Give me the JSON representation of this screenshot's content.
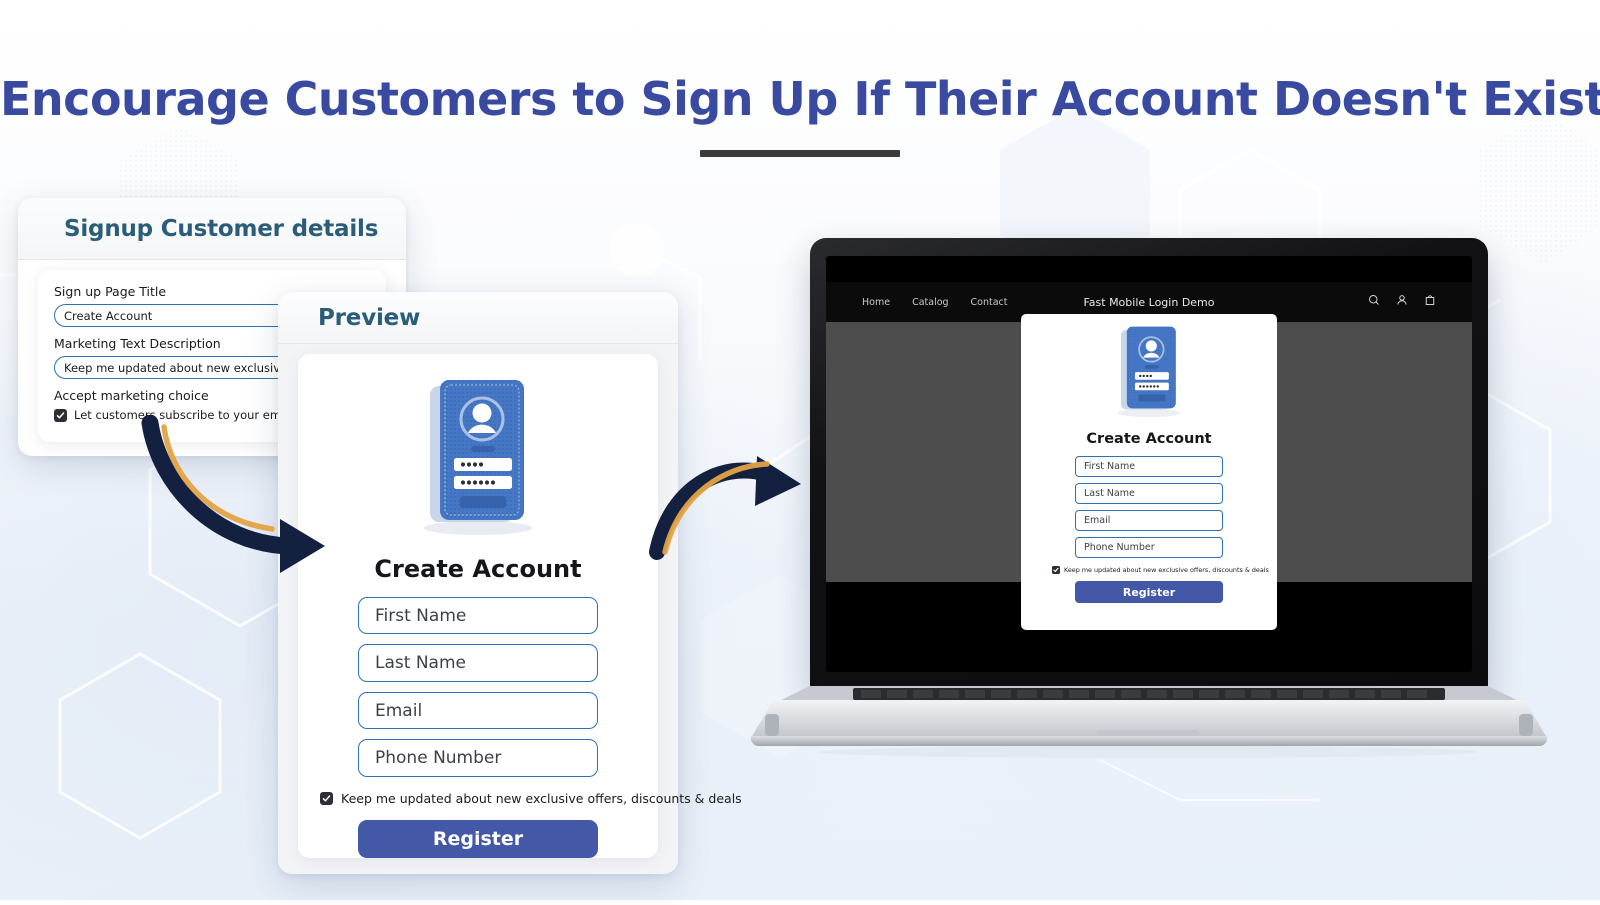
{
  "page": {
    "title": "Encourage Customers to Sign Up If Their Account Doesn't Exist"
  },
  "colors": {
    "title": "#3a4aa0",
    "panel_header_text": "#2b5d79",
    "input_border": "#2f6fb5",
    "primary_button": "#4359a8",
    "arrow_navy": "#14203f",
    "arrow_gold": "#e3a344",
    "screen_overlay": "#4d4d4d",
    "nav_bar": "#0b0b0c"
  },
  "settings_panel": {
    "header": "Signup Customer details",
    "fields": [
      {
        "label": "Sign up Page Title",
        "value": "Create Account"
      },
      {
        "label": "Marketing Text Description",
        "value": "Keep me updated about new exclusive offers, discounts & deals"
      }
    ],
    "checkbox_label": "Accept marketing choice",
    "checkbox_text": "Let customers subscribe to your email marketing campaigns",
    "checkbox_checked": true
  },
  "preview_panel": {
    "header": "Preview",
    "illustration": "mobile-login-illustration",
    "form": {
      "title": "Create Account",
      "inputs": [
        {
          "placeholder": "First Name"
        },
        {
          "placeholder": "Last Name"
        },
        {
          "placeholder": "Email"
        },
        {
          "placeholder": "Phone Number"
        }
      ],
      "consent_text": "Keep me updated about new exclusive offers, discounts & deals",
      "consent_checked": true,
      "submit_label": "Register"
    }
  },
  "laptop": {
    "nav": {
      "links": [
        "Home",
        "Catalog",
        "Contact"
      ],
      "brand": "Fast Mobile Login Demo",
      "icons": [
        "search-icon",
        "account-icon",
        "cart-icon"
      ]
    },
    "modal": {
      "illustration": "mobile-login-illustration",
      "title": "Create Account",
      "inputs": [
        {
          "placeholder": "First Name"
        },
        {
          "placeholder": "Last Name"
        },
        {
          "placeholder": "Email"
        },
        {
          "placeholder": "Phone Number"
        }
      ],
      "consent_text": "Keep me updated about new exclusive offers, discounts & deals",
      "consent_checked": true,
      "submit_label": "Register"
    }
  }
}
